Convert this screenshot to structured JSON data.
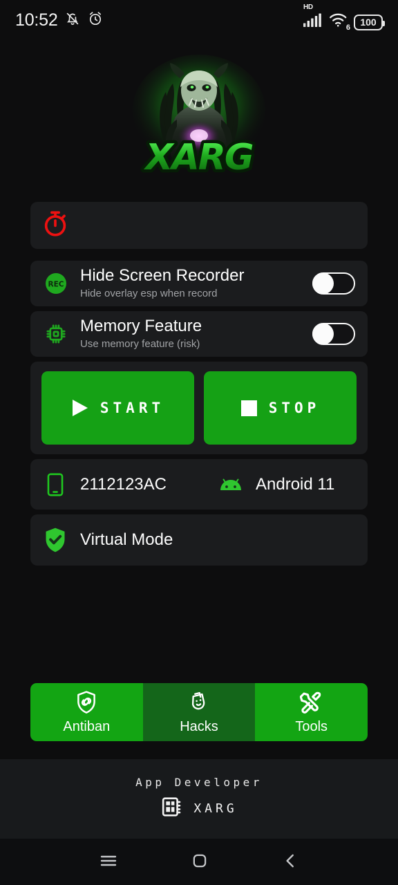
{
  "statusbar": {
    "time": "10:52",
    "icons_left": [
      "bell-muted-icon",
      "alarm-clock-icon"
    ],
    "network_tag": "HD",
    "wifi_generation": "6",
    "battery_percent": "100"
  },
  "logo": {
    "name": "XARG",
    "alt": "xarg-monster-logo",
    "glow_color": "#22e022"
  },
  "timer_card": {
    "icon": "stopwatch-icon",
    "icon_color": "#ee1111",
    "value": ""
  },
  "toggles": [
    {
      "icon": "rec-badge-icon",
      "icon_color": "#1fa81f",
      "title": "Hide Screen Recorder",
      "subtitle": "Hide overlay esp when record",
      "state": "off"
    },
    {
      "icon": "cpu-chip-icon",
      "icon_color": "#1fa81f",
      "title": "Memory Feature",
      "subtitle": "Use memory feature (risk)",
      "state": "off"
    }
  ],
  "actions": [
    {
      "label": "START",
      "icon": "play-icon",
      "color": "#15a115"
    },
    {
      "label": "STOP",
      "icon": "stop-square-icon",
      "color": "#15a115"
    }
  ],
  "device": {
    "model_icon": "smartphone-icon",
    "model": "2112123AC",
    "os_icon": "android-robot-icon",
    "os": "Android 11",
    "mode_icon": "shield-check-icon",
    "mode": "Virtual Mode"
  },
  "tabs": [
    {
      "label": "Antiban",
      "icon": "shield-link-icon",
      "color": "#13a513",
      "selected": false
    },
    {
      "label": "Hacks",
      "icon": "theater-masks-icon",
      "color": "#14661a",
      "selected": true
    },
    {
      "label": "Tools",
      "icon": "wrench-screwdriver-icon",
      "color": "#13a513",
      "selected": false
    }
  ],
  "footer": {
    "title": "App Developer",
    "icon": "chip-grid-icon",
    "developer": "XARG"
  },
  "navbar": [
    {
      "name": "recents-button",
      "icon": "hamburger-icon"
    },
    {
      "name": "home-button",
      "icon": "rounded-square-icon"
    },
    {
      "name": "back-button",
      "icon": "chevron-left-icon"
    }
  ]
}
